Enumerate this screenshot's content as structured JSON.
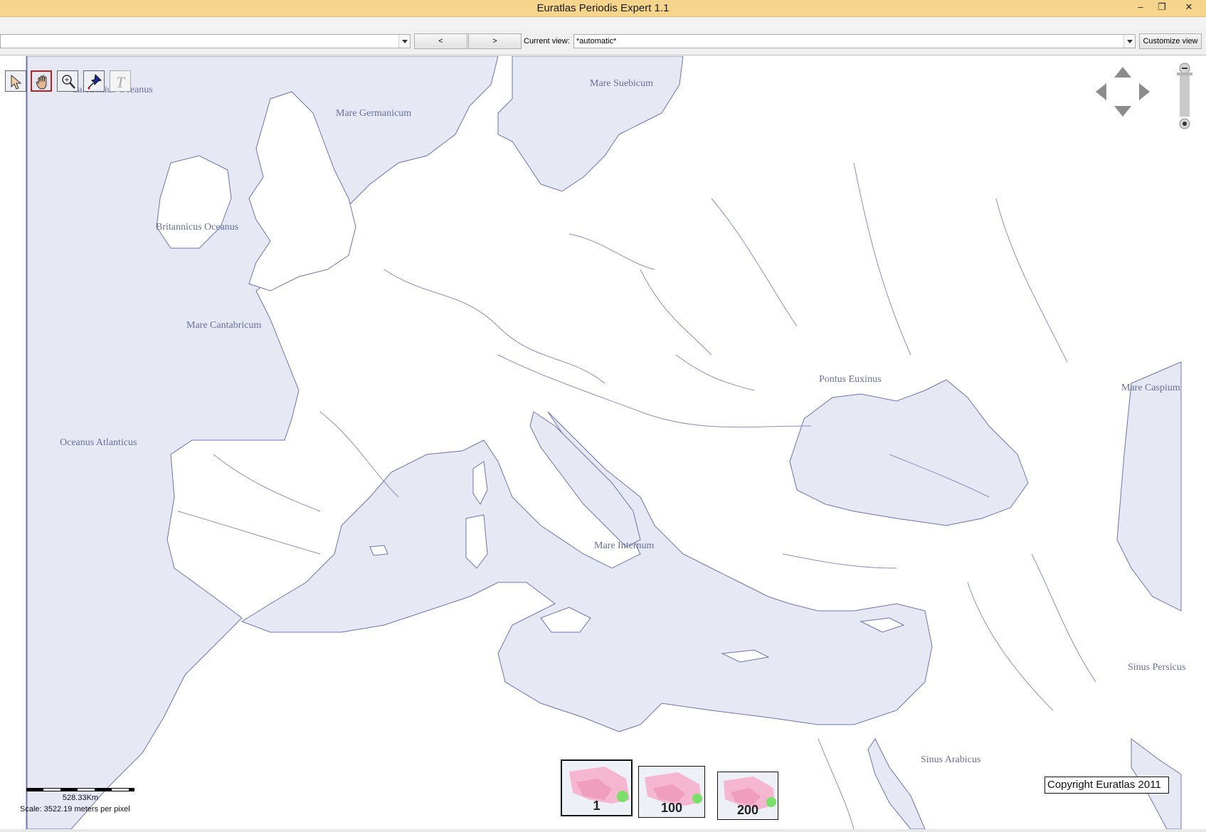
{
  "window": {
    "title": "Euratlas Periodis Expert 1.1",
    "minimize_glyph": "–",
    "restore_glyph": "❐",
    "close_glyph": "✕"
  },
  "toolbar": {
    "layer_select_value": "",
    "prev_label": "<",
    "next_label": ">",
    "current_view_label": "Current view:",
    "current_view_value": "*automatic*",
    "customize_view_label": "Customize view"
  },
  "map_tools": [
    {
      "name": "pointer-tool-icon",
      "active": false
    },
    {
      "name": "pan-hand-tool-icon",
      "active": true
    },
    {
      "name": "zoom-tool-icon",
      "active": false
    },
    {
      "name": "pin-tool-icon",
      "active": false
    },
    {
      "name": "text-tool-icon",
      "active": false
    }
  ],
  "sea_labels": {
    "caledonius": "Caledonius Oceanus",
    "germanicum": "Mare Germanicum",
    "suebicum": "Mare Suebicum",
    "britannicus": "Britannicus Oceanus",
    "cantabricum": "Mare Cantabricum",
    "atlanticus": "Oceanus Atlanticus",
    "internum": "Mare Internum",
    "euxinus": "Pontus Euxinus",
    "caspium": "Mare Caspium",
    "persicus": "Sinus Persicus",
    "arabicus": "Sinus Arabicus"
  },
  "thumbnails": [
    {
      "label": "1",
      "selected": true
    },
    {
      "label": "100",
      "selected": false
    },
    {
      "label": "200",
      "selected": false
    }
  ],
  "scale": {
    "distance": "528.33Km",
    "text": "Scale: 3522.19 meters per pixel"
  },
  "copyright": "Copyright Euratlas 2011",
  "colors": {
    "sea": "#e6e8f4",
    "coast": "#6d74a8",
    "land": "#ffffff",
    "titlebar": "#f5d58c",
    "label": "#6a6f9a"
  }
}
